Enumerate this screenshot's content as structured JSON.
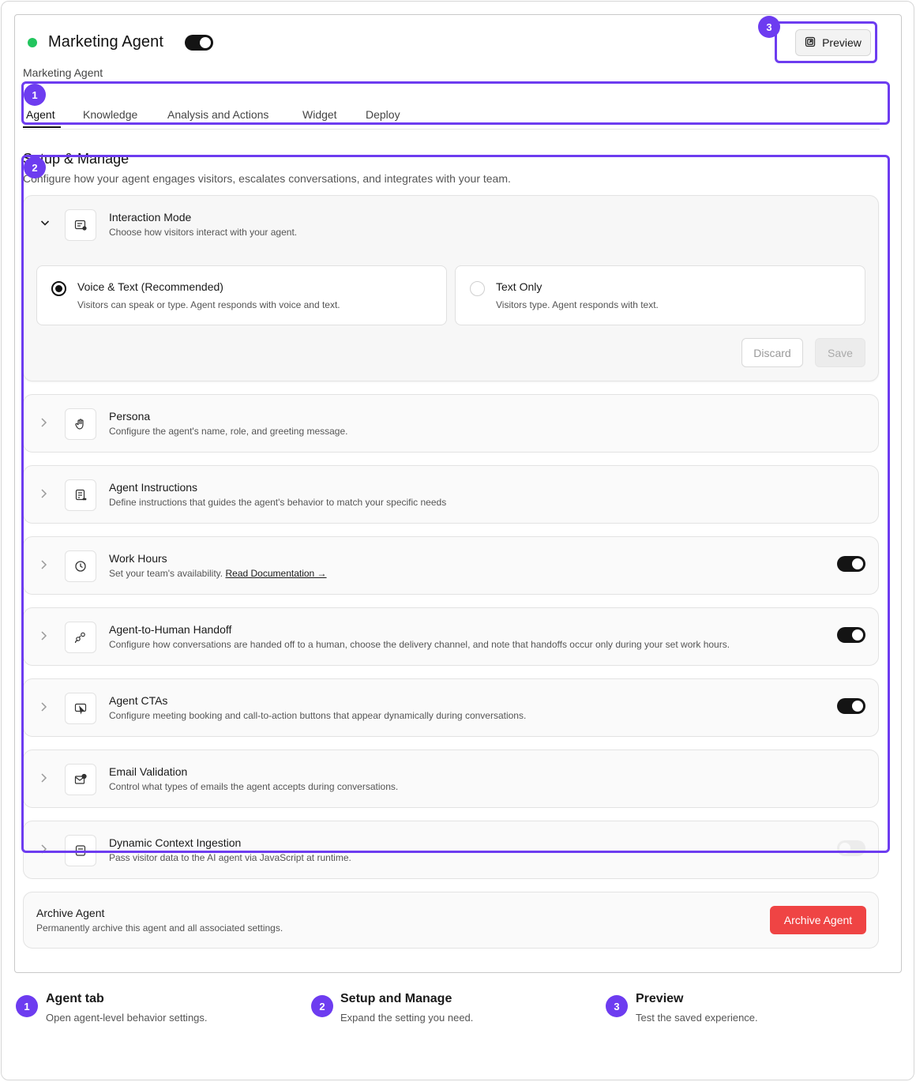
{
  "header": {
    "agent_name": "Marketing Agent",
    "breadcrumb": "Marketing Agent",
    "preview_label": "Preview",
    "agent_enabled": true,
    "status_color": "#22c55e"
  },
  "tabs": [
    {
      "label": "Agent",
      "active": true
    },
    {
      "label": "Knowledge",
      "active": false
    },
    {
      "label": "Analysis and Actions",
      "active": false
    },
    {
      "label": "Widget",
      "active": false
    },
    {
      "label": "Deploy",
      "active": false
    }
  ],
  "section": {
    "title": "Setup & Manage",
    "description": "Configure how your agent engages visitors, escalates conversations, and integrates with your team."
  },
  "interaction_mode": {
    "title": "Interaction Mode",
    "description": "Choose how visitors interact with your agent.",
    "icon": "interaction-mode-icon",
    "options": [
      {
        "title": "Voice & Text (Recommended)",
        "description": "Visitors can speak or type. Agent responds with voice and text.",
        "selected": true
      },
      {
        "title": "Text Only",
        "description": "Visitors type. Agent responds with text.",
        "selected": false
      }
    ],
    "discard_label": "Discard",
    "save_label": "Save"
  },
  "settings": [
    {
      "title": "Persona",
      "description": "Configure the agent's name, role, and greeting message.",
      "icon": "hand-wave-icon"
    },
    {
      "title": "Agent Instructions",
      "description": "Define instructions that guides the agent's behavior to match your specific needs",
      "icon": "instructions-icon"
    },
    {
      "title": "Work Hours",
      "description": "Set your team's availability.",
      "link": "Read Documentation →",
      "icon": "clock-icon",
      "toggle": true
    },
    {
      "title": "Agent-to-Human Handoff",
      "description": "Configure how conversations are handed off to a human, choose the delivery channel, and note that handoffs occur only during your set work hours.",
      "icon": "handoff-icon",
      "toggle": true
    },
    {
      "title": "Agent CTAs",
      "description": "Configure meeting booking and call-to-action buttons that appear dynamically during conversations.",
      "icon": "cta-icon",
      "toggle": true
    },
    {
      "title": "Email Validation",
      "description": "Control what types of emails the agent accepts during conversations.",
      "icon": "email-check-icon"
    },
    {
      "title": "Dynamic Context Ingestion",
      "description": "Pass visitor data to the AI agent via JavaScript at runtime.",
      "icon": "code-doc-icon",
      "toggle": false
    }
  ],
  "archive": {
    "title": "Archive Agent",
    "description": "Permanently archive this agent and all associated settings.",
    "button_label": "Archive Agent",
    "button_color": "#ef4444"
  },
  "callouts": [
    {
      "number": "1",
      "title": "Agent tab",
      "description": "Open agent-level behavior settings."
    },
    {
      "number": "2",
      "title": "Setup and Manage",
      "description": "Expand the setting you need."
    },
    {
      "number": "3",
      "title": "Preview",
      "description": "Test the saved experience."
    }
  ],
  "accent_color": "#6d3cf0"
}
